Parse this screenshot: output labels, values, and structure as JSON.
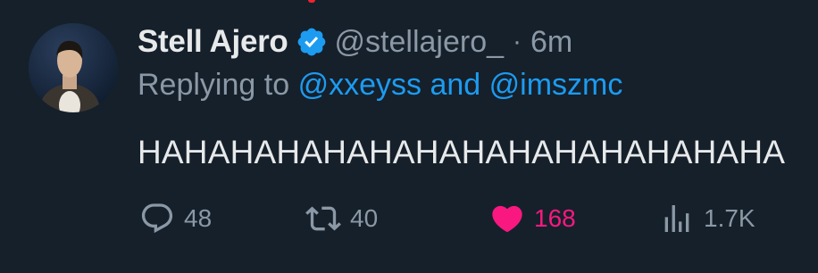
{
  "tweet": {
    "author": {
      "display_name": "Stell Ajero",
      "handle": "@stellajero_",
      "verified": true
    },
    "separator": "·",
    "time": "6m",
    "reply": {
      "prefix": "Replying to",
      "mention_1": "@xxeyss",
      "conjunction": "and",
      "mention_2": "@imszmc"
    },
    "text": "HAHAHAHAHAHAHAHAHAHAHAHAHAHA",
    "actions": {
      "replies": "48",
      "retweets": "40",
      "likes": "168",
      "views": "1.7K"
    },
    "icons": {
      "reply": "reply-icon",
      "retweet": "retweet-icon",
      "like": "heart-icon",
      "views": "views-icon",
      "verified": "verified-badge-icon"
    },
    "colors": {
      "background": "#15202b",
      "text_primary": "#e7e9ea",
      "text_secondary": "#8b98a5",
      "accent": "#1d9bf0",
      "like": "#f91880"
    }
  }
}
